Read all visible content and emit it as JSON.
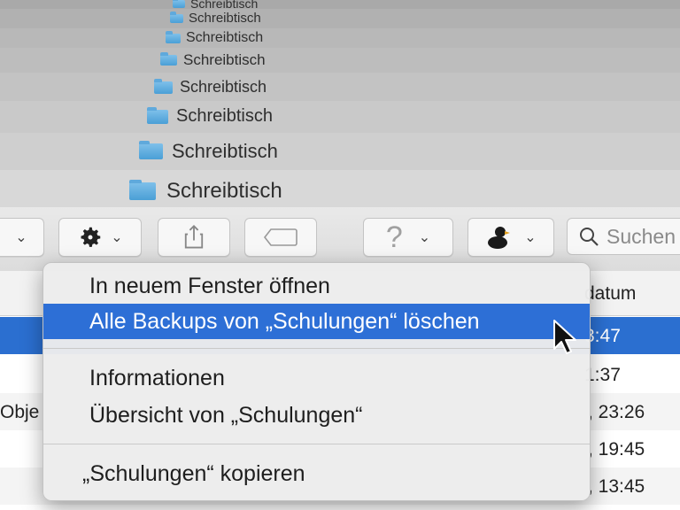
{
  "stacked_windows": {
    "title": "Schreibtisch",
    "rows": [
      "Schreibtisch",
      "Schreibtisch",
      "Schreibtisch",
      "Schreibtisch",
      "Schreibtisch",
      "Schreibtisch",
      "Schreibtisch",
      "Schreibtisch"
    ]
  },
  "toolbar": {
    "search_placeholder": "Suchen"
  },
  "list": {
    "header_date": "datum",
    "rows": [
      {
        "left": "",
        "right": "3:47",
        "selected": true
      },
      {
        "left": "",
        "right": "1:37"
      },
      {
        "left": "Obje",
        "right": ", 23:26"
      },
      {
        "left": "",
        "right": ", 19:45"
      },
      {
        "left": "",
        "right": ", 13:45"
      }
    ]
  },
  "context_menu": {
    "items": [
      {
        "label": "In neuem Fenster öffnen"
      },
      {
        "label": "Alle Backups von „Schulungen“ löschen",
        "highlighted": true
      },
      {
        "label": "Informationen"
      },
      {
        "label": "Übersicht von „Schulungen“"
      },
      {
        "label": "„Schulungen“ kopieren"
      }
    ]
  },
  "colors": {
    "highlight": "#2d6fd6",
    "folder": "#4a9fd6"
  }
}
